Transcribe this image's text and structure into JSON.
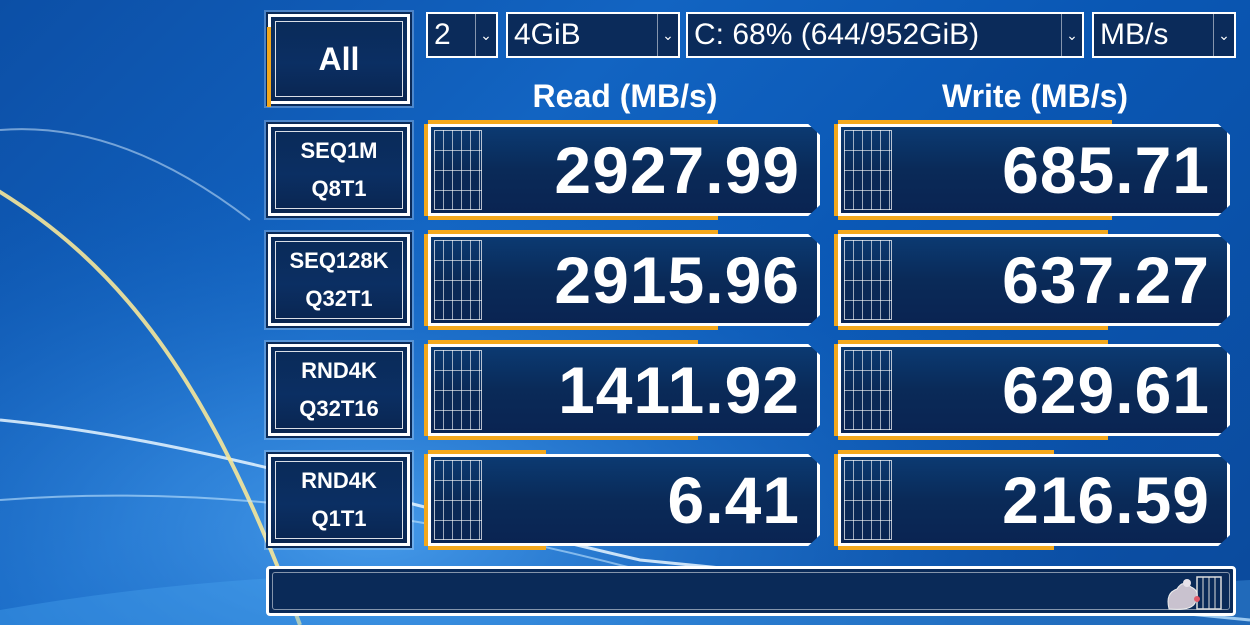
{
  "controls": {
    "count": "2",
    "size": "4GiB",
    "drive": "C: 68% (644/952GiB)",
    "unit": "MB/s"
  },
  "all_button": "All",
  "headers": {
    "read": "Read (MB/s)",
    "write": "Write (MB/s)"
  },
  "tests": [
    {
      "line1": "SEQ1M",
      "line2": "Q8T1",
      "read": "2927.99",
      "write": "685.71",
      "read_fill": 0.74,
      "write_fill": 0.7
    },
    {
      "line1": "SEQ128K",
      "line2": "Q32T1",
      "read": "2915.96",
      "write": "637.27",
      "read_fill": 0.74,
      "write_fill": 0.69
    },
    {
      "line1": "RND4K",
      "line2": "Q32T16",
      "read": "1411.92",
      "write": "629.61",
      "read_fill": 0.69,
      "write_fill": 0.69
    },
    {
      "line1": "RND4K",
      "line2": "Q1T1",
      "read": "6.41",
      "write": "216.59",
      "read_fill": 0.3,
      "write_fill": 0.55
    }
  ],
  "status_text": "",
  "colors": {
    "accent": "#f3a81d",
    "panel": "#0a2a58",
    "border": "#ffffff",
    "text": "#ffffff"
  },
  "icons": [
    "chevron-down-icon",
    "grill-icon",
    "mascot-icon"
  ]
}
